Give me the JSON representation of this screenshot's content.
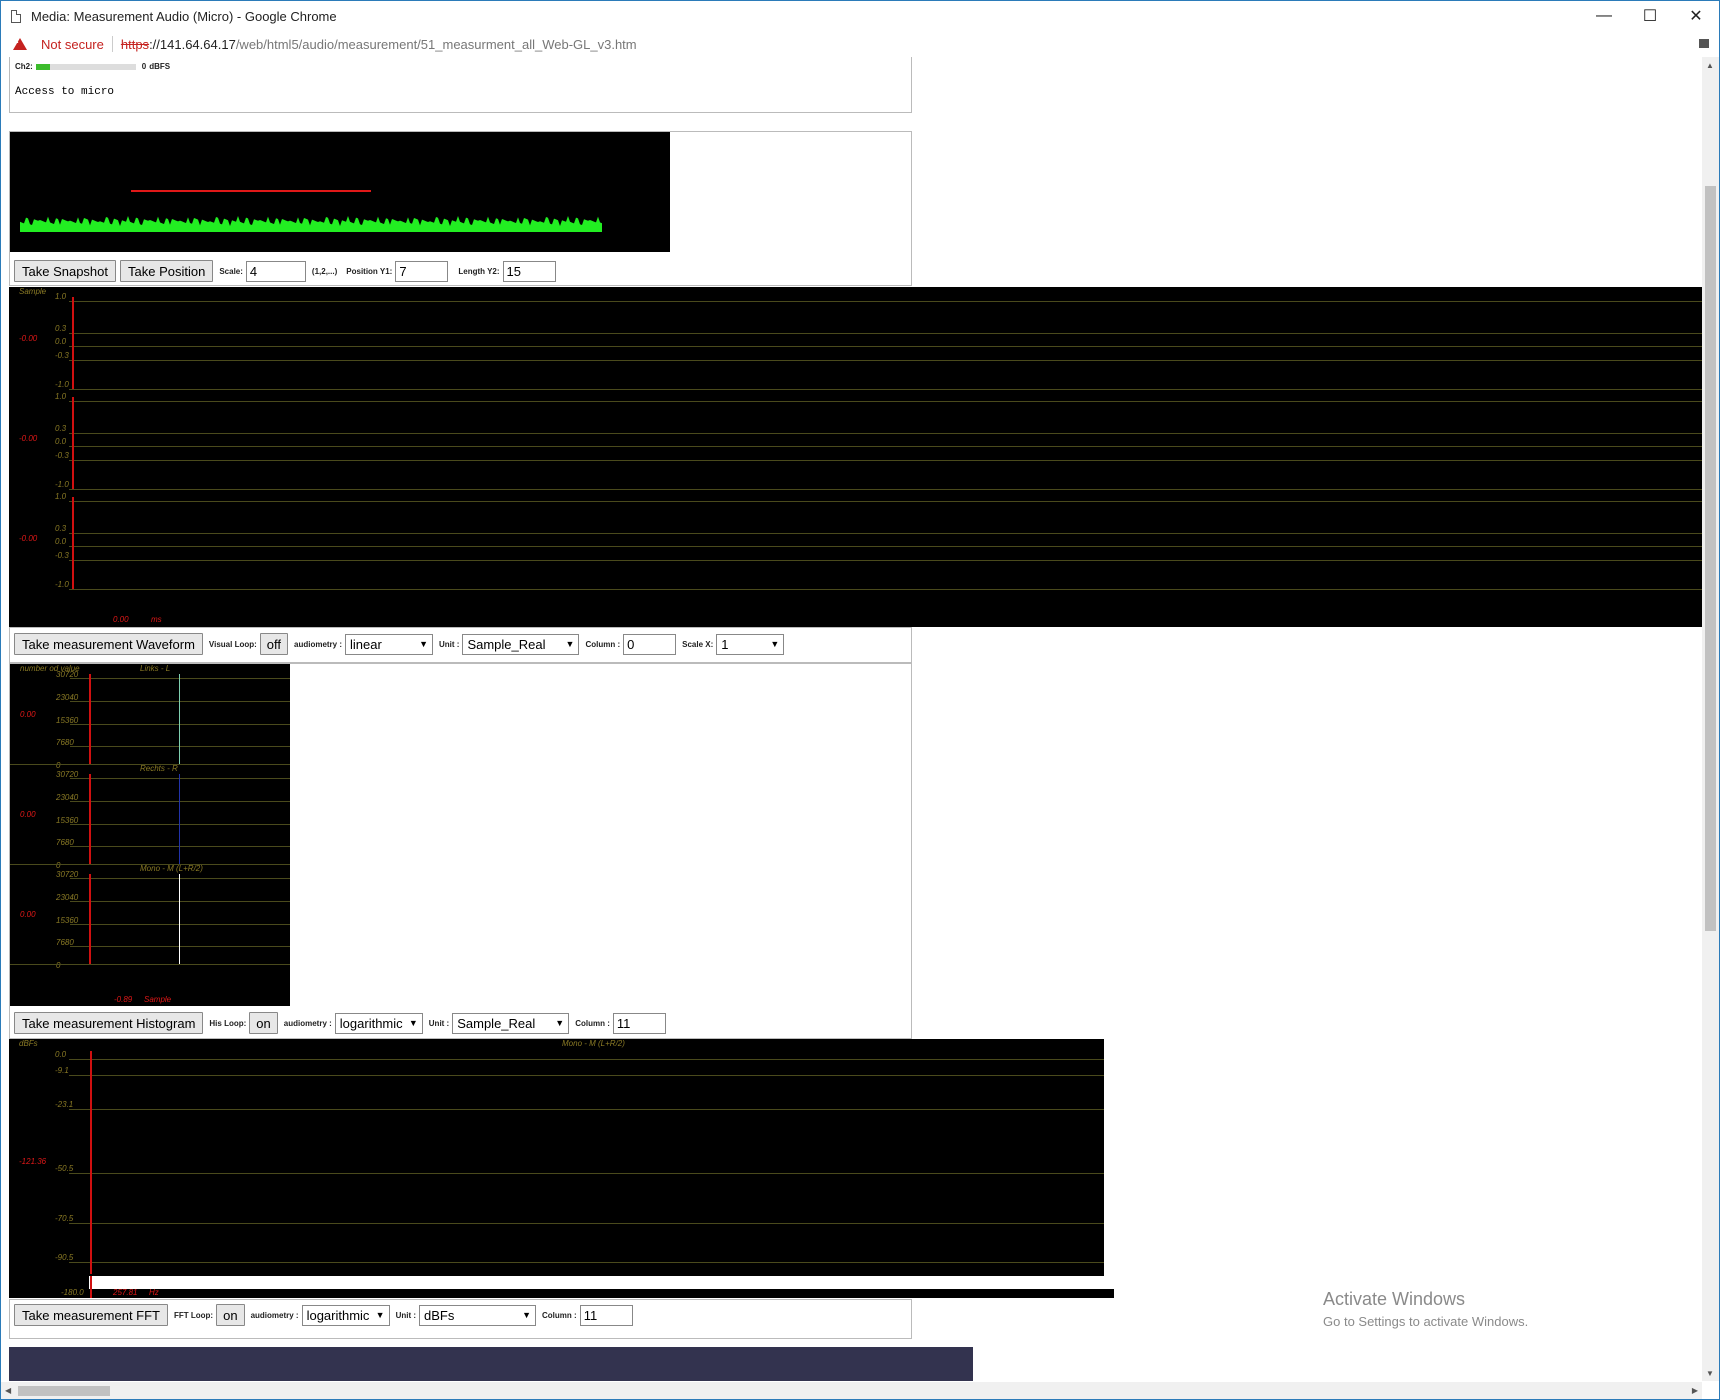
{
  "window": {
    "title": "Media: Measurement Audio (Micro) - Google Chrome",
    "minimize": "—",
    "maximize": "☐",
    "close": "✕"
  },
  "addressbar": {
    "security_label": "Not secure",
    "url_scheme": "https",
    "url_host": "://141.64.64.17",
    "url_path": "/web/html5/audio/measurement/51_measurment_all_Web-GL_v3.htm"
  },
  "top_panel": {
    "ch2_label": "Ch2:",
    "ch2_value": "0",
    "ch2_unit": "dBFS",
    "status_text": "Access to micro"
  },
  "snapshot": {
    "take_snapshot": "Take Snapshot",
    "take_position": "Take Position",
    "scale_label": "Scale:",
    "scale_value": "4",
    "scale_hint": "(1,2,...)",
    "position_label": "Position Y1:",
    "position_value": "7",
    "length_label": "Length Y2:",
    "length_value": "15"
  },
  "waveform": {
    "title": "Sample",
    "ticks": [
      "1.0",
      "0.3",
      "0.0",
      "-0.3",
      "-1.0"
    ],
    "channel_readout": "-0.00",
    "x_readout": "0.00",
    "x_unit": "ms",
    "take_button": "Take measurement Waveform",
    "loop_label": "Visual Loop:",
    "loop_value": "off",
    "audiometry_label": "audiometry :",
    "audiometry_value": "linear",
    "unit_label": "Unit :",
    "unit_value": "Sample_Real",
    "column_label": "Column :",
    "column_value": "0",
    "scalex_label": "Scale X:",
    "scalex_value": "1"
  },
  "histogram": {
    "y_title": "number od value",
    "channels": [
      "Links - L",
      "Rechts - R",
      "Mono - M (L+R/2)"
    ],
    "ticks": [
      "30720",
      "23040",
      "15360",
      "7680",
      "0"
    ],
    "channel_readout": "0.00",
    "x_readout": "-0.89",
    "x_unit": "Sample",
    "take_button": "Take measurement Histogram",
    "loop_label": "His Loop:",
    "loop_value": "on",
    "audiometry_label": "audiometry :",
    "audiometry_value": "logarithmic",
    "unit_label": "Unit :",
    "unit_value": "Sample_Real",
    "column_label": "Column :",
    "column_value": "11"
  },
  "fft": {
    "y_title": "dBFs",
    "channel_title": "Mono - M (L+R/2)",
    "ticks": [
      "0.0",
      "-9.1",
      "-23.1",
      "-50.5",
      "-70.5",
      "-90.5",
      "-180.0"
    ],
    "readout": "-121.36",
    "x_readout": "257.81",
    "x_unit": "Hz",
    "take_button": "Take measurement FFT",
    "loop_label": "FFT Loop:",
    "loop_value": "on",
    "audiometry_label": "audiometry :",
    "audiometry_value": "logarithmic",
    "unit_label": "Unit :",
    "unit_value": "dBFs",
    "column_label": "Column :",
    "column_value": "11"
  },
  "watermark": {
    "line1": "Activate Windows",
    "line2": "Go to Settings to activate Windows."
  },
  "colors": {
    "spectrum": "#22ee22",
    "cursor": "#e01818",
    "axis_text": "#8a7a25",
    "grid": "#4a4a1c",
    "hist_left": "#7fd0b0",
    "hist_right": "#2233aa",
    "hist_mono": "#ffffff"
  }
}
